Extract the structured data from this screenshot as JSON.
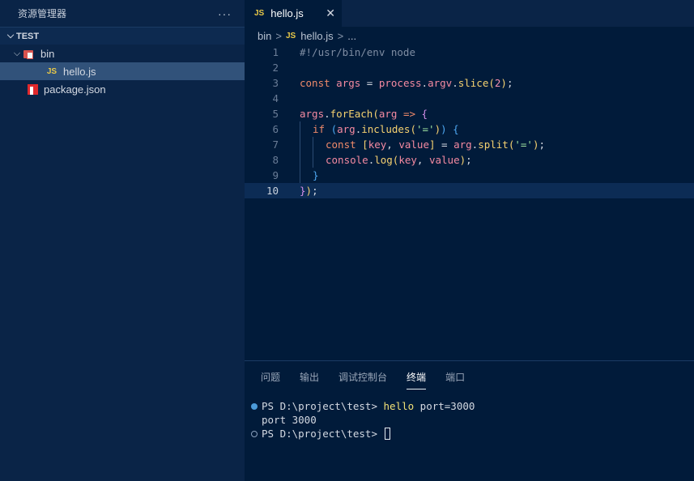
{
  "sidebar": {
    "title": "资源管理器",
    "more": "···",
    "section": "TEST",
    "items": [
      {
        "label": "bin",
        "icon": "folder-bin-icon"
      },
      {
        "label": "hello.js",
        "icon": "js-file-icon"
      },
      {
        "label": "package.json",
        "icon": "npm-file-icon"
      }
    ]
  },
  "editor": {
    "tab": {
      "label": "hello.js",
      "icon_text": "JS",
      "close": "✕"
    },
    "breadcrumb": {
      "folder": "bin",
      "icon_text": "JS",
      "file": "hello.js",
      "sep": ">",
      "more": "..."
    },
    "lines": [
      {
        "n": "1"
      },
      {
        "n": "2"
      },
      {
        "n": "3"
      },
      {
        "n": "4"
      },
      {
        "n": "5"
      },
      {
        "n": "6"
      },
      {
        "n": "7"
      },
      {
        "n": "8"
      },
      {
        "n": "9"
      },
      {
        "n": "10"
      }
    ],
    "code": {
      "l1": "#!/usr/bin/env node",
      "l3": {
        "kw": "const",
        "var": "args",
        "eq": " = ",
        "obj": "process",
        "dot": ".",
        "prop": "argv",
        "dot2": ".",
        "fn": "slice",
        "open": "(",
        "num": "2",
        "close": ")",
        "end": ";"
      },
      "l5": {
        "obj": "args",
        "dot": ".",
        "fn": "forEach",
        "open": "(",
        "param": "arg",
        "arrow": " => ",
        "brace": "{"
      },
      "l6": {
        "kw": "if",
        "open": " (",
        "obj": "arg",
        "dot": ".",
        "fn": "includes",
        "p1": "(",
        "str": "'='",
        "p2": ")",
        "close": ")",
        "brace": " {"
      },
      "l7": {
        "kw": "const",
        "lb": " [",
        "v1": "key",
        "comma": ", ",
        "v2": "value",
        "rb": "]",
        "eq": " = ",
        "obj": "arg",
        "dot": ".",
        "fn": "split",
        "p1": "(",
        "str": "'='",
        "p2": ")",
        "end": ";"
      },
      "l8": {
        "obj": "console",
        "dot": ".",
        "fn": "log",
        "p1": "(",
        "a1": "key",
        "comma": ", ",
        "a2": "value",
        "p2": ")",
        "end": ";"
      },
      "l9": "}",
      "l10": {
        "b": "}",
        "p": ")",
        "end": ";"
      }
    }
  },
  "panel": {
    "tabs": [
      "问题",
      "输出",
      "调试控制台",
      "终端",
      "端口"
    ],
    "active_tab": "终端",
    "terminal": [
      {
        "prompt": "PS D:\\project\\test> ",
        "cmd": "hello",
        "args": " port=3000"
      },
      {
        "text": "port 3000"
      },
      {
        "prompt": "PS D:\\project\\test> "
      }
    ]
  },
  "colors": {
    "background": "#011b3a",
    "sidebar": "#0a2447",
    "selection": "#31527a",
    "accent": "#4b9bd9"
  }
}
